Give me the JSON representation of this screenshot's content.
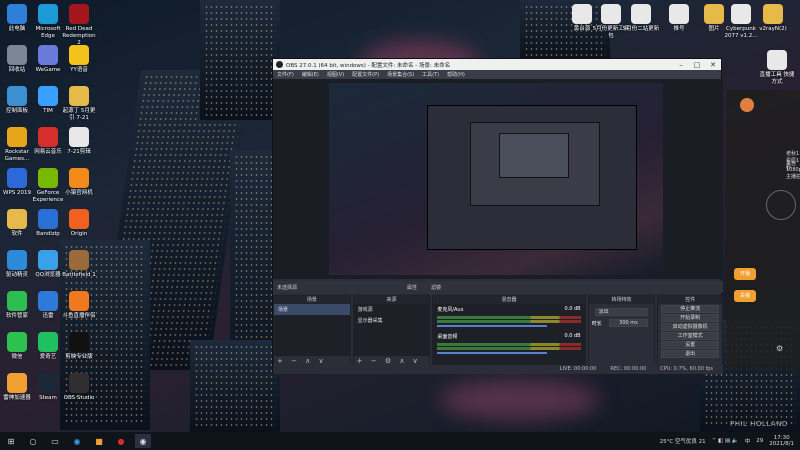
{
  "desktop_left": [
    {
      "label": "此电脑",
      "color": "#2f7fd8"
    },
    {
      "label": "Microsoft Edge",
      "color": "#1d9ad6"
    },
    {
      "label": "Red Dead Redemption 2",
      "color": "#a3161b"
    },
    {
      "label": "回收站",
      "color": "#7a8694"
    },
    {
      "label": "WeGame",
      "color": "#6a7ad8"
    },
    {
      "label": "YY语音",
      "color": "#f3c21b"
    },
    {
      "label": "控制面板",
      "color": "#3c8fd0"
    },
    {
      "label": "TIM",
      "color": "#3aa0ff"
    },
    {
      "label": "起源丁 5月更引 7-21",
      "color": "#e5b94a"
    },
    {
      "label": "Rockstar Games...",
      "color": "#e6a61a"
    },
    {
      "label": "网易云音乐",
      "color": "#d62d2d"
    },
    {
      "label": "7-21剪辑",
      "color": "#e8e8e8"
    },
    {
      "label": "WPS 2019",
      "color": "#2d68d8"
    },
    {
      "label": "GeForce Experience",
      "color": "#76b900"
    },
    {
      "label": "小猿官网机",
      "color": "#f08a1a"
    },
    {
      "label": "软件",
      "color": "#e5b94a"
    },
    {
      "label": "Bandizip",
      "color": "#2a6fd6"
    },
    {
      "label": "Origin",
      "color": "#f06020"
    },
    {
      "label": "驱动精灵",
      "color": "#2d8ad8"
    },
    {
      "label": "QQ浏览器",
      "color": "#3aa0e8"
    },
    {
      "label": "Battlefield 1",
      "color": "#9a6a3a"
    },
    {
      "label": "软件管家",
      "color": "#2dbd50"
    },
    {
      "label": "迅雷",
      "color": "#2d7ad8"
    },
    {
      "label": "斗鱼直播伴侣",
      "color": "#f07820"
    },
    {
      "label": "微信",
      "color": "#2dc150"
    },
    {
      "label": "爱奇艺",
      "color": "#20c060"
    },
    {
      "label": "剪映专业版",
      "color": "#111111"
    },
    {
      "label": "雷神加速器",
      "color": "#f0a030"
    },
    {
      "label": "Steam",
      "color": "#1b2838"
    },
    {
      "label": "OBS Studio",
      "color": "#302e31"
    }
  ],
  "desktop_top": [
    {
      "label": "黄台源",
      "color": "#e8e8e8"
    },
    {
      "label": "5月份更新工具包",
      "color": "#e8e8e8"
    },
    {
      "label": "5月份二站更新",
      "color": "#e8e8e8"
    },
    {
      "label": "推号",
      "color": "#e8e8e8"
    },
    {
      "label": "图片",
      "color": "#e5b94a"
    },
    {
      "label": "Cyberpunk 2077 v1.2...",
      "color": "#e8e8e8"
    },
    {
      "label": "v2rayN(2)",
      "color": "#e5b94a"
    }
  ],
  "desktop_right": [
    {
      "label": "直播工具 快捷方式",
      "color": "#e8e8e8"
    }
  ],
  "obs": {
    "title": "OBS 27.0.1 (64 bit, windows) - 配置文件: 未命名 - 场景: 未命名",
    "menu": [
      "文件(F)",
      "编辑(E)",
      "视图(V)",
      "配置文件(P)",
      "场景集合(S)",
      "工具(T)",
      "帮助(H)"
    ],
    "no_source": "未选择源",
    "props_label": "属性",
    "filters_label": "滤镜",
    "docks": {
      "scenes": {
        "title": "场景",
        "items": [
          "场景"
        ]
      },
      "sources": {
        "title": "来源",
        "items": [
          "游戏源",
          "显示器采集"
        ]
      },
      "mixer": {
        "title": "混音器",
        "channels": [
          {
            "name": "麦克风/Aux",
            "db": "0.0 dB"
          },
          {
            "name": "桌面音频",
            "db": "0.0 dB"
          }
        ]
      },
      "transitions": {
        "title": "转场特效",
        "select": "淡出",
        "duration_label": "时长",
        "duration": "300 ms"
      },
      "controls": {
        "title": "控件",
        "buttons": [
          "停止推流",
          "开始录制",
          "启动虚拟摄像机",
          "工作室模式",
          "设置",
          "退出"
        ]
      }
    },
    "status": {
      "live": "LIVE: 00:00:00",
      "rec": "REC: 00:00:00",
      "cpu": "CPU: 0.7%, 60.00 fps"
    }
  },
  "right_app": {
    "text1": "老秋1 看原1秒",
    "text2": "来自1080p 主播拍",
    "pill1": "开播",
    "pill2": "关播"
  },
  "taskbar": {
    "weather": "25°C 空气优良 21",
    "time": "17:30",
    "date": "2021/8/1",
    "lang": "中",
    "badge": "29"
  },
  "watermark": "PHIL HOLLAND"
}
